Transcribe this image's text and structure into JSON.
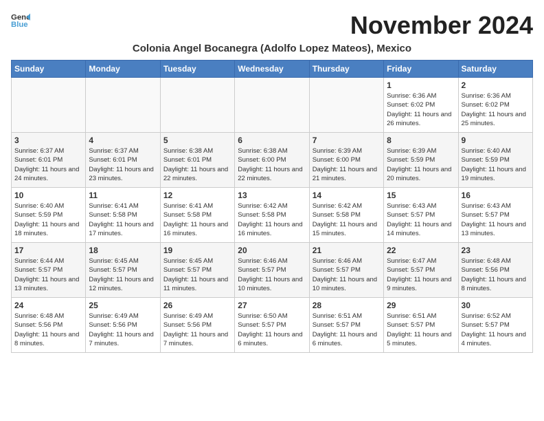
{
  "logo": {
    "line1": "General",
    "line2": "Blue"
  },
  "title": "November 2024",
  "location": "Colonia Angel Bocanegra (Adolfo Lopez Mateos), Mexico",
  "days_of_week": [
    "Sunday",
    "Monday",
    "Tuesday",
    "Wednesday",
    "Thursday",
    "Friday",
    "Saturday"
  ],
  "weeks": [
    [
      {
        "day": "",
        "info": ""
      },
      {
        "day": "",
        "info": ""
      },
      {
        "day": "",
        "info": ""
      },
      {
        "day": "",
        "info": ""
      },
      {
        "day": "",
        "info": ""
      },
      {
        "day": "1",
        "info": "Sunrise: 6:36 AM\nSunset: 6:02 PM\nDaylight: 11 hours and 26 minutes."
      },
      {
        "day": "2",
        "info": "Sunrise: 6:36 AM\nSunset: 6:02 PM\nDaylight: 11 hours and 25 minutes."
      }
    ],
    [
      {
        "day": "3",
        "info": "Sunrise: 6:37 AM\nSunset: 6:01 PM\nDaylight: 11 hours and 24 minutes."
      },
      {
        "day": "4",
        "info": "Sunrise: 6:37 AM\nSunset: 6:01 PM\nDaylight: 11 hours and 23 minutes."
      },
      {
        "day": "5",
        "info": "Sunrise: 6:38 AM\nSunset: 6:01 PM\nDaylight: 11 hours and 22 minutes."
      },
      {
        "day": "6",
        "info": "Sunrise: 6:38 AM\nSunset: 6:00 PM\nDaylight: 11 hours and 22 minutes."
      },
      {
        "day": "7",
        "info": "Sunrise: 6:39 AM\nSunset: 6:00 PM\nDaylight: 11 hours and 21 minutes."
      },
      {
        "day": "8",
        "info": "Sunrise: 6:39 AM\nSunset: 5:59 PM\nDaylight: 11 hours and 20 minutes."
      },
      {
        "day": "9",
        "info": "Sunrise: 6:40 AM\nSunset: 5:59 PM\nDaylight: 11 hours and 19 minutes."
      }
    ],
    [
      {
        "day": "10",
        "info": "Sunrise: 6:40 AM\nSunset: 5:59 PM\nDaylight: 11 hours and 18 minutes."
      },
      {
        "day": "11",
        "info": "Sunrise: 6:41 AM\nSunset: 5:58 PM\nDaylight: 11 hours and 17 minutes."
      },
      {
        "day": "12",
        "info": "Sunrise: 6:41 AM\nSunset: 5:58 PM\nDaylight: 11 hours and 16 minutes."
      },
      {
        "day": "13",
        "info": "Sunrise: 6:42 AM\nSunset: 5:58 PM\nDaylight: 11 hours and 16 minutes."
      },
      {
        "day": "14",
        "info": "Sunrise: 6:42 AM\nSunset: 5:58 PM\nDaylight: 11 hours and 15 minutes."
      },
      {
        "day": "15",
        "info": "Sunrise: 6:43 AM\nSunset: 5:57 PM\nDaylight: 11 hours and 14 minutes."
      },
      {
        "day": "16",
        "info": "Sunrise: 6:43 AM\nSunset: 5:57 PM\nDaylight: 11 hours and 13 minutes."
      }
    ],
    [
      {
        "day": "17",
        "info": "Sunrise: 6:44 AM\nSunset: 5:57 PM\nDaylight: 11 hours and 13 minutes."
      },
      {
        "day": "18",
        "info": "Sunrise: 6:45 AM\nSunset: 5:57 PM\nDaylight: 11 hours and 12 minutes."
      },
      {
        "day": "19",
        "info": "Sunrise: 6:45 AM\nSunset: 5:57 PM\nDaylight: 11 hours and 11 minutes."
      },
      {
        "day": "20",
        "info": "Sunrise: 6:46 AM\nSunset: 5:57 PM\nDaylight: 11 hours and 10 minutes."
      },
      {
        "day": "21",
        "info": "Sunrise: 6:46 AM\nSunset: 5:57 PM\nDaylight: 11 hours and 10 minutes."
      },
      {
        "day": "22",
        "info": "Sunrise: 6:47 AM\nSunset: 5:57 PM\nDaylight: 11 hours and 9 minutes."
      },
      {
        "day": "23",
        "info": "Sunrise: 6:48 AM\nSunset: 5:56 PM\nDaylight: 11 hours and 8 minutes."
      }
    ],
    [
      {
        "day": "24",
        "info": "Sunrise: 6:48 AM\nSunset: 5:56 PM\nDaylight: 11 hours and 8 minutes."
      },
      {
        "day": "25",
        "info": "Sunrise: 6:49 AM\nSunset: 5:56 PM\nDaylight: 11 hours and 7 minutes."
      },
      {
        "day": "26",
        "info": "Sunrise: 6:49 AM\nSunset: 5:56 PM\nDaylight: 11 hours and 7 minutes."
      },
      {
        "day": "27",
        "info": "Sunrise: 6:50 AM\nSunset: 5:57 PM\nDaylight: 11 hours and 6 minutes."
      },
      {
        "day": "28",
        "info": "Sunrise: 6:51 AM\nSunset: 5:57 PM\nDaylight: 11 hours and 6 minutes."
      },
      {
        "day": "29",
        "info": "Sunrise: 6:51 AM\nSunset: 5:57 PM\nDaylight: 11 hours and 5 minutes."
      },
      {
        "day": "30",
        "info": "Sunrise: 6:52 AM\nSunset: 5:57 PM\nDaylight: 11 hours and 4 minutes."
      }
    ]
  ]
}
